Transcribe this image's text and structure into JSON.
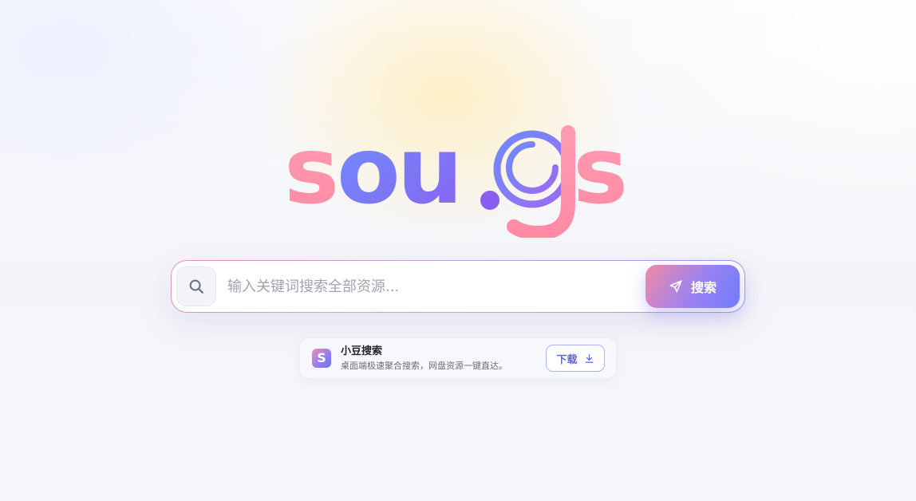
{
  "logo": {
    "text": "sou.gs",
    "colors": {
      "pink": "#ff8fab",
      "violet": "#7a74f4",
      "blue": "#6f86fb"
    }
  },
  "search": {
    "placeholder": "输入关键词搜索全部资源...",
    "value": "",
    "button_label": "搜索",
    "icons": {
      "field": "search-icon",
      "button": "send-icon"
    }
  },
  "promo": {
    "logo_letter": "S",
    "title": "小豆搜索",
    "description": "桌面端极速聚合搜索，网盘资源一键直达。",
    "download_label": "下载",
    "icon": "download-icon"
  },
  "colors": {
    "accent": "#6f7cfb",
    "accent_pink": "#f08aa6",
    "background": "#f6f7fb"
  }
}
